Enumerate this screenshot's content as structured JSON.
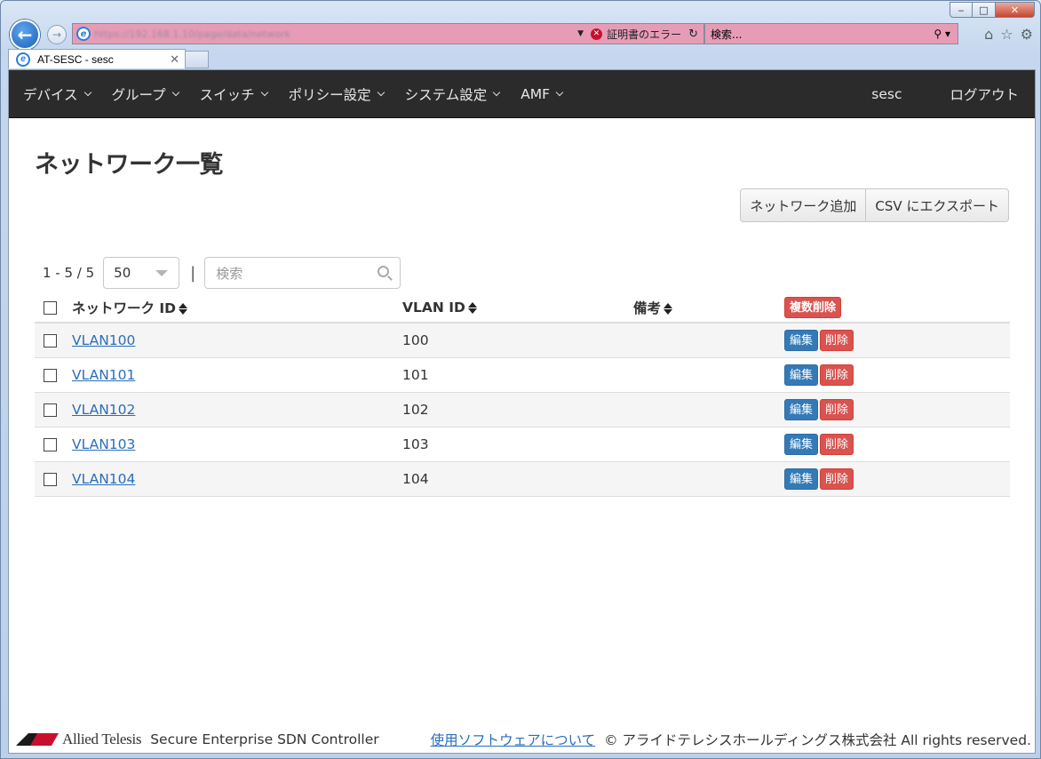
{
  "browser": {
    "address_url": "https://192.168.1.10/page/data/network",
    "cert_error": "証明書のエラー",
    "search_placeholder": "検索...",
    "tab_title": "AT-SESC - sesc"
  },
  "nav": {
    "items": [
      "デバイス",
      "グループ",
      "スイッチ",
      "ポリシー設定",
      "システム設定",
      "AMF"
    ],
    "user": "sesc",
    "logout": "ログアウト"
  },
  "page": {
    "title": "ネットワーク一覧",
    "add_button": "ネットワーク追加",
    "export_button": "CSV にエクスポート",
    "range": "1 - 5 / 5",
    "per_page": "50",
    "separator": "|",
    "search_placeholder": "検索"
  },
  "table": {
    "headers": [
      "ネットワーク ID",
      "VLAN ID",
      "備考"
    ],
    "bulk_delete": "複数削除",
    "edit_label": "編集",
    "delete_label": "削除",
    "rows": [
      {
        "network_id": "VLAN100",
        "vlan_id": "100",
        "note": ""
      },
      {
        "network_id": "VLAN101",
        "vlan_id": "101",
        "note": ""
      },
      {
        "network_id": "VLAN102",
        "vlan_id": "102",
        "note": ""
      },
      {
        "network_id": "VLAN103",
        "vlan_id": "103",
        "note": ""
      },
      {
        "network_id": "VLAN104",
        "vlan_id": "104",
        "note": ""
      }
    ]
  },
  "footer": {
    "logo_text": "Allied Telesis",
    "product": "Secure Enterprise SDN Controller",
    "software_link": "使用ソフトウェアについて",
    "copyright": "© アライドテレシスホールディングス株式会社 All rights reserved."
  },
  "colors": {
    "navbar": "#2b2b2b",
    "primary": "#337ab7",
    "danger": "#d9534f",
    "link": "#2a6ebb",
    "address_bar": "#e79cb6"
  }
}
